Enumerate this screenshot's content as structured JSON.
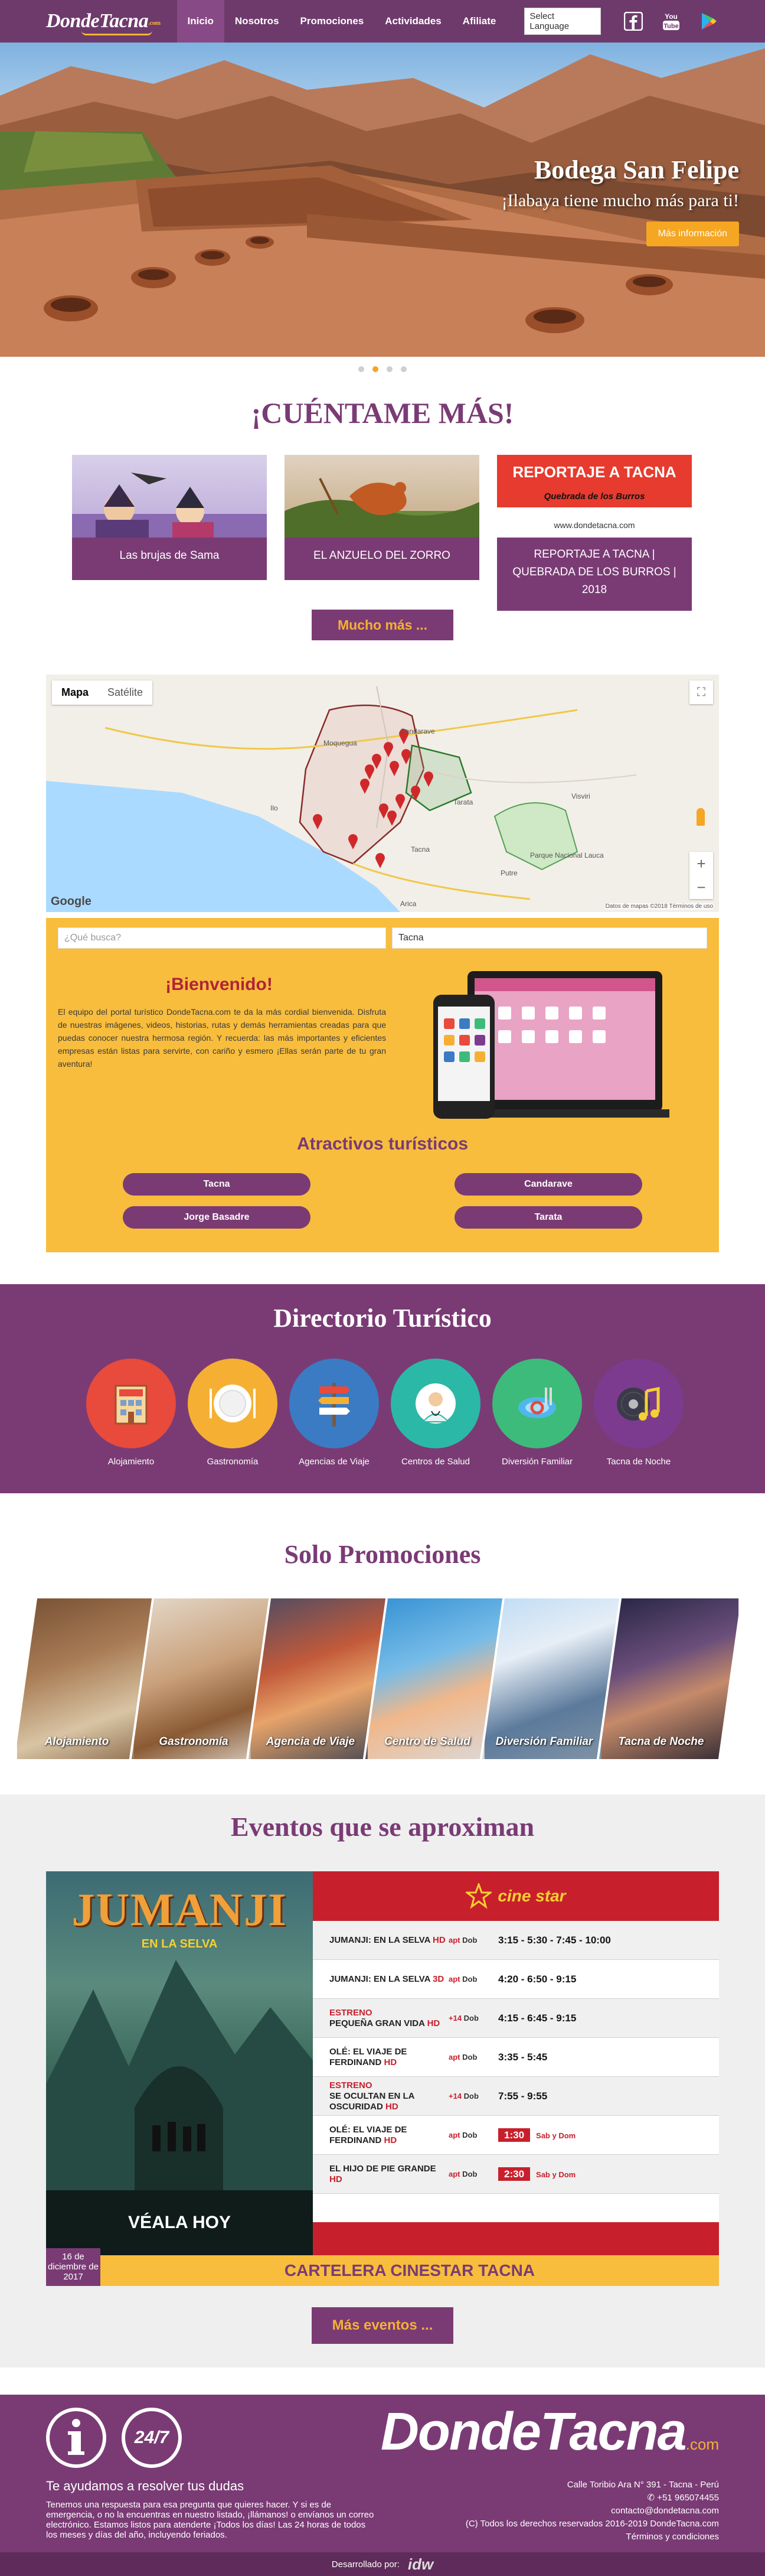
{
  "nav": {
    "brand": "DondeTacna",
    "brand_suffix": ".com",
    "links": [
      "Inicio",
      "Nosotros",
      "Promociones",
      "Actividades",
      "Afiliate"
    ],
    "language_select": "Select Language",
    "social_icons": [
      "facebook-icon",
      "youtube-icon",
      "google-play-icon"
    ]
  },
  "hero": {
    "title": "Bodega San Felipe",
    "subtitle": "¡Ilabaya tiene mucho más para ti!",
    "button": "Más información",
    "slides_total": 4,
    "active_slide": 2
  },
  "stories": {
    "title": "¡CUÉNTAME MÁS!",
    "cards": [
      {
        "label": "Las brujas de Sama"
      },
      {
        "label": "EL ANZUELO DEL ZORRO"
      },
      {
        "label": "REPORTAJE A TACNA | QUEBRADA DE LOS BURROS | 2018",
        "image_heading": "REPORTAJE A TACNA",
        "image_sub": "Quebrada de los Burros",
        "image_site": "www.dondetacna.com"
      }
    ],
    "more_button": "Mucho más ..."
  },
  "map": {
    "tabs": [
      "Mapa",
      "Satélite"
    ],
    "active_tab": "Mapa",
    "zoom_in": "+",
    "zoom_out": "−",
    "attribution": "Datos de mapas ©2018  Términos de uso",
    "google": "Google",
    "place_labels": [
      "Moquegua",
      "Ilo",
      "Tacna",
      "Candarave",
      "Tarata",
      "Putre",
      "Arica",
      "Parque Nacional Lauca",
      "Visviri"
    ]
  },
  "welcome": {
    "search_placeholder": "¿Qué busca?",
    "city_select": "Tacna",
    "title": "¡Bienvenido!",
    "text": "El equipo del portal turístico DondeTacna.com te da la más cordial bienvenida. Disfruta de nuestras imágenes, videos, historias, rutas y demás herramientas creadas para que puedas conocer nuestra hermosa región. Y recuerda: las más importantes y eficientes empresas están listas para servirte, con cariño y esmero ¡Ellas serán parte de tu gran aventura!",
    "attractions_title": "Atractivos turísticos",
    "attractions": [
      "Tacna",
      "Candarave",
      "Jorge Basadre",
      "Tarata"
    ]
  },
  "directory": {
    "title": "Directorio Turístico",
    "items": [
      {
        "label": "Alojamiento",
        "color": "#e84a3c",
        "icon": "hotel-icon"
      },
      {
        "label": "Gastronomía",
        "color": "#f5b034",
        "icon": "plate-icon"
      },
      {
        "label": "Agencias de Viaje",
        "color": "#3a7bc4",
        "icon": "signpost-icon"
      },
      {
        "label": "Centros de Salud",
        "color": "#2cb8a6",
        "icon": "doctor-icon"
      },
      {
        "label": "Diversión Familiar",
        "color": "#3dbb7a",
        "icon": "pool-icon"
      },
      {
        "label": "Tacna de Noche",
        "color": "#7d3b8f",
        "icon": "music-icon"
      }
    ]
  },
  "promos": {
    "title": "Solo Promociones",
    "items": [
      "Alojamiento",
      "Gastronomía",
      "Agencia de Viaje",
      "Centro de Salud",
      "Diversión Familiar",
      "Tacna de Noche"
    ]
  },
  "events": {
    "title": "Eventos que se aproximan",
    "poster_title": "JUMANJI",
    "poster_sub": "EN LA SELVA",
    "poster_tagline": "VÉALA HOY",
    "cinema": "cine star",
    "movies": [
      {
        "name": "JUMANJI: EN LA SELVA",
        "badge": "HD",
        "prefix": "",
        "rating": "apt",
        "lang": "Dob",
        "times": "3:15 - 5:30 - 7:45 - 10:00",
        "extra": ""
      },
      {
        "name": "JUMANJI: EN LA SELVA",
        "badge": "3D",
        "prefix": "",
        "rating": "apt",
        "lang": "Dob",
        "times": "4:20 - 6:50 - 9:15",
        "extra": ""
      },
      {
        "name": "PEQUEÑA GRAN VIDA",
        "badge": "HD",
        "prefix": "ESTRENO",
        "rating": "+14",
        "lang": "Dob",
        "times": "4:15 - 6:45 - 9:15",
        "extra": ""
      },
      {
        "name": "OLÉ: EL VIAJE DE FERDINAND",
        "badge": "HD",
        "prefix": "",
        "rating": "apt",
        "lang": "Dob",
        "times": "3:35 - 5:45",
        "extra": ""
      },
      {
        "name": "SE OCULTAN EN LA OSCURIDAD",
        "badge": "HD",
        "prefix": "ESTRENO",
        "rating": "+14",
        "lang": "Dob",
        "times": "7:55 - 9:55",
        "extra": ""
      },
      {
        "name": "OLÉ: EL VIAJE DE FERDINAND",
        "badge": "HD",
        "prefix": "",
        "rating": "apt",
        "lang": "Dob",
        "times": "1:30",
        "extra": "Sab y Dom"
      },
      {
        "name": "EL HIJO DE PIE GRANDE",
        "badge": "HD",
        "prefix": "",
        "rating": "apt",
        "lang": "Dob",
        "times": "2:30",
        "extra": "Sab y Dom"
      }
    ],
    "date": "16 de diciembre de 2017",
    "bar_label": "CARTELERA CINESTAR TACNA",
    "more_button": "Más eventos ..."
  },
  "footer": {
    "help_title": "Te ayudamos a resolver tus dudas",
    "help_text": "Tenemos una respuesta para esa pregunta que quieres hacer. Y si es de emergencia, o no la encuentras en nuestro listado, ¡llámanos! o envíanos un correo electrónico. Estamos listos para atenderte ¡Todos los días! Las 24 horas de todos los meses y días del año, incluyendo feriados.",
    "brand": "DondeTacna",
    "brand_suffix": ".com",
    "address": "Calle Toribio Ara N° 391 - Tacna - Perú",
    "phone": "+51 965074455",
    "email": "contacto@dondetacna.com",
    "copyright": "(C) Todos los derechos reservados 2016-2019 DondeTacna.com",
    "terms": "Términos y condiciones",
    "developed_by": "Desarrollado por:",
    "dev_logo": "idw",
    "badge_247": "24/7"
  }
}
